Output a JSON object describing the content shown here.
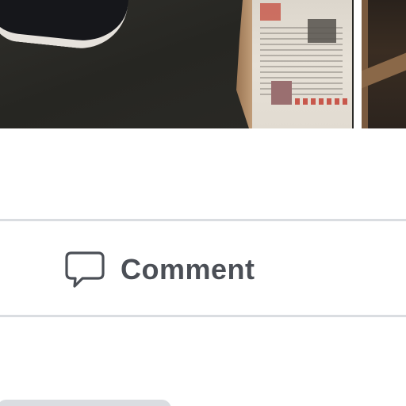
{
  "post": {
    "photos": [
      {
        "name": "feed-photo-main",
        "alt": ""
      },
      {
        "name": "feed-photo-secondary",
        "alt": ""
      }
    ]
  },
  "actions": {
    "comment_label": "Comment",
    "comment_icon": "speech-bubble-icon"
  },
  "colors": {
    "divider": "#dadde1",
    "action_text": "#4b4f56",
    "background": "#ffffff"
  }
}
